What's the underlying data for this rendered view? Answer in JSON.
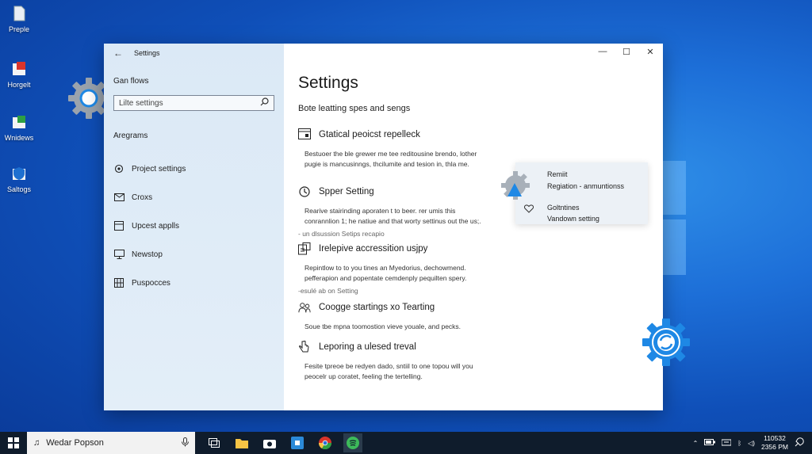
{
  "desktop": {
    "icons": [
      {
        "label": "Preple",
        "icon": "document-icon"
      },
      {
        "label": "Horgelt",
        "icon": "app-red-icon"
      },
      {
        "label": "Wnidews",
        "icon": "app-green-icon"
      },
      {
        "label": "Saltogs",
        "icon": "shield-icon"
      }
    ]
  },
  "window": {
    "title": "Settings",
    "controls": {
      "minimize": "—",
      "maximize": "☐",
      "close": "✕"
    }
  },
  "sidebar": {
    "heading": "Gan flows",
    "search_placeholder": "Lilte settings",
    "section_label": "Aregrams",
    "items": [
      {
        "label": "Project settings",
        "icon": "home-gear-icon"
      },
      {
        "label": "Croxs",
        "icon": "mail-icon"
      },
      {
        "label": "Upcest applls",
        "icon": "apps-icon"
      },
      {
        "label": "Newstop",
        "icon": "monitor-icon"
      },
      {
        "label": "Puspocces",
        "icon": "grid-icon"
      }
    ]
  },
  "main": {
    "title": "Settings",
    "subtitle": "Bote leatting spes and sengs",
    "settings": [
      {
        "title": "Gtatical peoicst repelleck",
        "desc1": "Bestuoer the ble grewer me tee reditousine brendo, lother",
        "desc2": "pugie is mancusinngs, thcilumite and tesion in, thla me.",
        "link": ""
      },
      {
        "title": "Spper Setting",
        "desc1": "Rearive stairinding aporaten t to beer. rer umis this",
        "desc2": "conrannlion 1; he natiue and that worty settinus out the us;.",
        "link": "- un dlsussion Setips recapio"
      },
      {
        "title": "Irelepive accressition usjpy",
        "desc1": "Repintlow to to you tines an Myedorius, dechowmend.",
        "desc2": "pefferapion and popentate cemdenply pequilten spery.",
        "link": "-esulé ab on Setting"
      },
      {
        "title": "Coogge startings xo Tearting",
        "desc1": "Soue tbe mpna toomostion vieve youale, and pecks.",
        "desc2": "",
        "link": ""
      },
      {
        "title": "Leporing a ulesed treval",
        "desc1": "Fesite tpreoe be redyen dado, sntiil to one topou will you",
        "desc2": "peocelr up coratet, feeling the tertelling.",
        "link": ""
      }
    ]
  },
  "popup": {
    "line1": "Remiit",
    "line2": "Regiation - anmuntionss",
    "line3": "Goltntines",
    "line4": "Vandown setting"
  },
  "taskbar": {
    "search_text": "Wedar Popson",
    "apps": [
      "task-view-icon",
      "file-explorer-icon",
      "camera-icon",
      "store-icon",
      "chrome-icon",
      "spotify-icon"
    ],
    "tray_text": "ᛒ",
    "clock_time": "110532",
    "clock_date": "2356 PM"
  },
  "colors": {
    "desktop_blue": "#1d6fd8",
    "sidebar_bg": "#dbe9f6",
    "taskbar_bg": "#0f1c2c",
    "gear_grey": "#9aa3ad",
    "gear_blue": "#1e88e5"
  }
}
